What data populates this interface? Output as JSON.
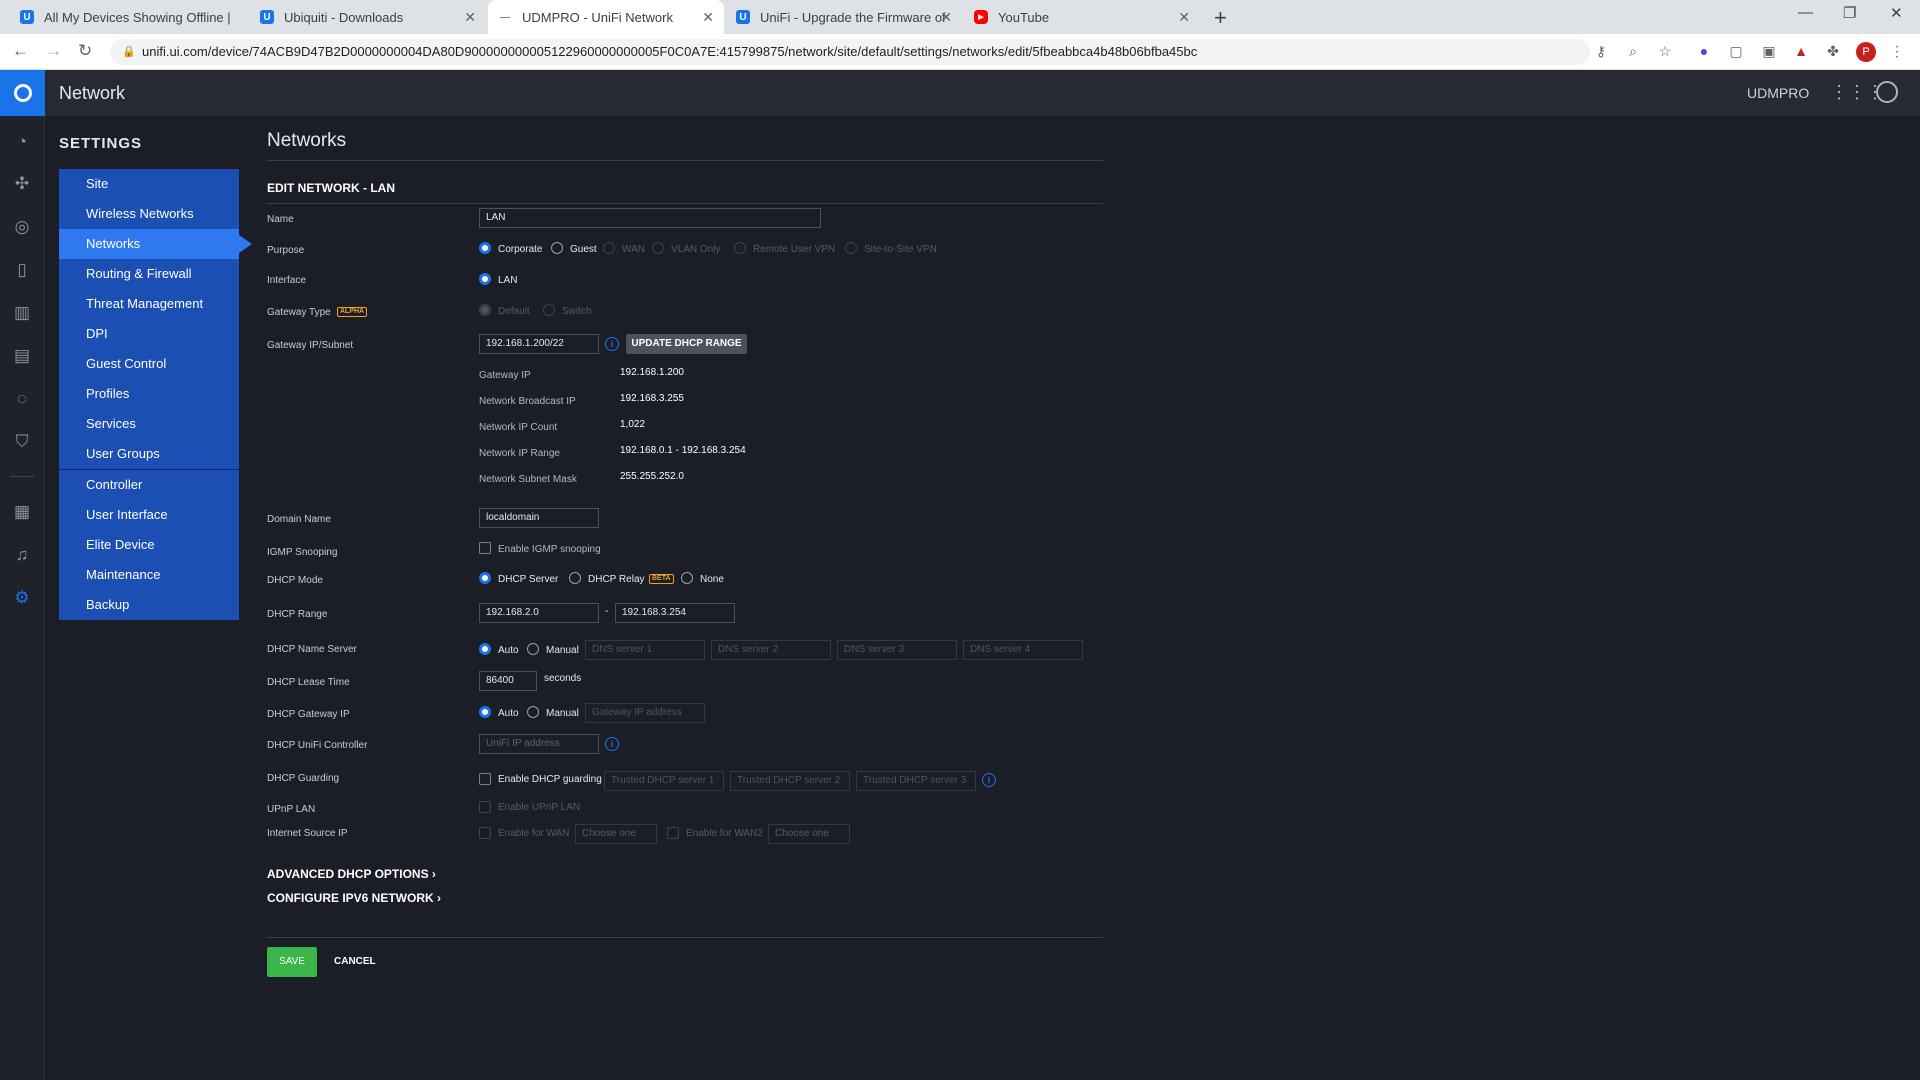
{
  "browser": {
    "tabs": [
      {
        "title": "All My Devices Showing Offline |",
        "icon": "unifi-community-icon"
      },
      {
        "title": "Ubiquiti - Downloads",
        "icon": "ubiquiti-icon"
      },
      {
        "title": "UDMPRO - UniFi Network",
        "icon": "loading-icon"
      },
      {
        "title": "UniFi - Upgrade the Firmware of",
        "icon": "ubiquiti-icon"
      },
      {
        "title": "YouTube",
        "icon": "youtube-icon"
      }
    ],
    "url": "unifi.ui.com/device/74ACB9D47B2D0000000004DA80D900000000005122960000000005F0C0A7E:415799875/network/site/default/settings/networks/edit/5fbeabbca4b48b06bfba45bc",
    "profile_initial": "P"
  },
  "header": {
    "app_title": "Network",
    "device_name": "UDMPRO"
  },
  "settings": {
    "title": "SETTINGS",
    "items_top": [
      "Site",
      "Wireless Networks",
      "Networks",
      "Routing & Firewall",
      "Threat Management",
      "DPI",
      "Guest Control",
      "Profiles",
      "Services",
      "User Groups"
    ],
    "items_bottom": [
      "Controller",
      "User Interface",
      "Elite Device",
      "Maintenance",
      "Backup"
    ],
    "active": "Networks"
  },
  "page": {
    "title": "Networks",
    "edit_header": "EDIT NETWORK - LAN"
  },
  "form": {
    "name_label": "Name",
    "name_value": "LAN",
    "purpose_label": "Purpose",
    "purpose_options": [
      "Corporate",
      "Guest",
      "WAN",
      "VLAN Only",
      "Remote User VPN",
      "Site-to-Site VPN"
    ],
    "interface_label": "Interface",
    "interface_value": "LAN",
    "gateway_type_label": "Gateway Type",
    "gateway_type_badge": "ALPHA",
    "gateway_type_options": [
      "Default",
      "Switch"
    ],
    "gateway_subnet_label": "Gateway IP/Subnet",
    "gateway_subnet_value": "192.168.1.200/22",
    "update_dhcp_button": "UPDATE DHCP RANGE",
    "subnet_info": [
      {
        "label": "Gateway IP",
        "value": "192.168.1.200"
      },
      {
        "label": "Network Broadcast IP",
        "value": "192.168.3.255"
      },
      {
        "label": "Network IP Count",
        "value": "1,022"
      },
      {
        "label": "Network IP Range",
        "value": "192.168.0.1 - 192.168.3.254"
      },
      {
        "label": "Network Subnet Mask",
        "value": "255.255.252.0"
      }
    ],
    "domain_label": "Domain Name",
    "domain_value": "localdomain",
    "igmp_label": "IGMP Snooping",
    "igmp_check": "Enable IGMP snooping",
    "dhcp_mode_label": "DHCP Mode",
    "dhcp_mode_options": [
      "DHCP Server",
      "DHCP Relay",
      "None"
    ],
    "dhcp_relay_badge": "BETA",
    "dhcp_range_label": "DHCP Range",
    "dhcp_range_start": "192.168.2.0",
    "dhcp_range_sep": "-",
    "dhcp_range_end": "192.168.3.254",
    "dns_label": "DHCP Name Server",
    "dns_auto": "Auto",
    "dns_manual": "Manual",
    "dns_placeholders": [
      "DNS server 1",
      "DNS server 2",
      "DNS server 3",
      "DNS server 4"
    ],
    "lease_label": "DHCP Lease Time",
    "lease_value": "86400",
    "lease_unit": "seconds",
    "gwip_label": "DHCP Gateway IP",
    "gwip_auto": "Auto",
    "gwip_manual": "Manual",
    "gwip_placeholder": "Gateway IP address",
    "controller_label": "DHCP UniFi Controller",
    "controller_placeholder": "UniFi IP address",
    "guarding_label": "DHCP Guarding",
    "guarding_check": "Enable DHCP guarding",
    "guarding_placeholders": [
      "Trusted DHCP server 1",
      "Trusted DHCP server 2",
      "Trusted DHCP server 3"
    ],
    "upnp_label": "UPnP LAN",
    "upnp_check": "Enable UPnP LAN",
    "source_label": "Internet Source IP",
    "wan_check": "Enable for WAN",
    "wan2_check": "Enable for WAN2",
    "choose_one": "Choose one",
    "advanced_link": "ADVANCED DHCP OPTIONS",
    "ipv6_link": "CONFIGURE IPV6 NETWORK",
    "save": "SAVE",
    "cancel": "CANCEL"
  }
}
